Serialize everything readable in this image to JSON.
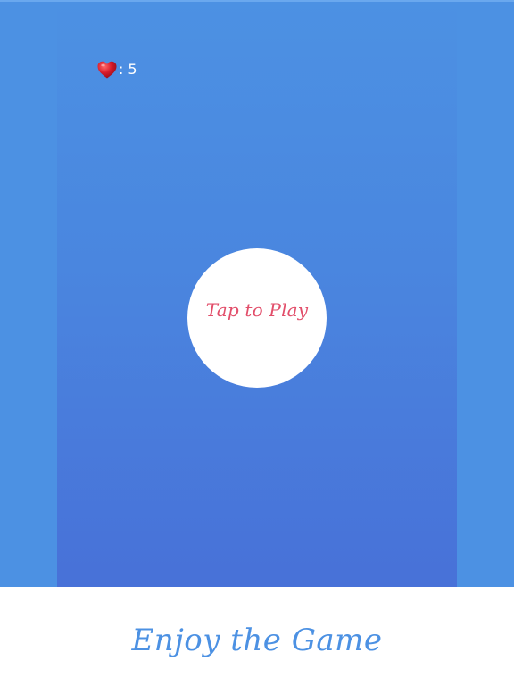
{
  "hud": {
    "lives_icon": "heart-icon",
    "lives_separator": ":",
    "lives_count": "5"
  },
  "play_button": {
    "label": "Tap to Play"
  },
  "footer": {
    "tagline": "Enjoy the Game"
  },
  "colors": {
    "background": "#4c91e3",
    "game_area_top": "#4c91e3",
    "game_area_bottom": "#4871d8",
    "play_button_bg": "#ffffff",
    "play_label": "#e24e6a",
    "footer_bg": "#ffffff",
    "footer_text": "#4c91e3",
    "heart": "#d81b2a"
  }
}
